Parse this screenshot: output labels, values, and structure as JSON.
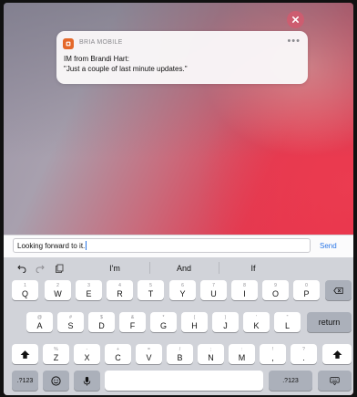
{
  "notification": {
    "app_name": "BRIA MOBILE",
    "more_glyph": "•••",
    "title": "IM from Brandi Hart:",
    "body": "\"Just a couple of last minute updates.\""
  },
  "compose": {
    "input_value": "Looking forward to it.",
    "send_label": "Send"
  },
  "predictive": {
    "suggestions": [
      "I'm",
      "And",
      "If"
    ]
  },
  "keyboard": {
    "row1": [
      {
        "alt": "1",
        "main": "Q"
      },
      {
        "alt": "2",
        "main": "W"
      },
      {
        "alt": "3",
        "main": "E"
      },
      {
        "alt": "4",
        "main": "R"
      },
      {
        "alt": "5",
        "main": "T"
      },
      {
        "alt": "6",
        "main": "Y"
      },
      {
        "alt": "7",
        "main": "U"
      },
      {
        "alt": "8",
        "main": "I"
      },
      {
        "alt": "9",
        "main": "O"
      },
      {
        "alt": "0",
        "main": "P"
      }
    ],
    "row2": [
      {
        "alt": "@",
        "main": "A"
      },
      {
        "alt": "#",
        "main": "S"
      },
      {
        "alt": "$",
        "main": "D"
      },
      {
        "alt": "&",
        "main": "F"
      },
      {
        "alt": "*",
        "main": "G"
      },
      {
        "alt": "(",
        "main": "H"
      },
      {
        "alt": ")",
        "main": "J"
      },
      {
        "alt": "'",
        "main": "K"
      },
      {
        "alt": "\"",
        "main": "L"
      }
    ],
    "return_label": "return",
    "row3": [
      {
        "alt": "%",
        "main": "Z"
      },
      {
        "alt": "-",
        "main": "X"
      },
      {
        "alt": "+",
        "main": "C"
      },
      {
        "alt": "=",
        "main": "V"
      },
      {
        "alt": "/",
        "main": "B"
      },
      {
        "alt": ";",
        "main": "N"
      },
      {
        "alt": ":",
        "main": "M"
      },
      {
        "alt": "!",
        "main": ","
      },
      {
        "alt": "?",
        "main": "."
      }
    ],
    "numbers_label": ".?123",
    "numbers_label_right": ".?123"
  },
  "icons": {
    "close": "close-icon",
    "app": "bria-app-icon",
    "undo": "undo-icon",
    "redo": "redo-icon",
    "paste": "paste-icon",
    "backspace": "backspace-icon",
    "shift": "shift-icon",
    "emoji": "emoji-icon",
    "microphone": "microphone-icon",
    "hide_keyboard": "hide-keyboard-icon"
  },
  "colors": {
    "send": "#2a76e6",
    "app_icon": "#e4682a",
    "wallpaper_red": "#ee2a45"
  }
}
